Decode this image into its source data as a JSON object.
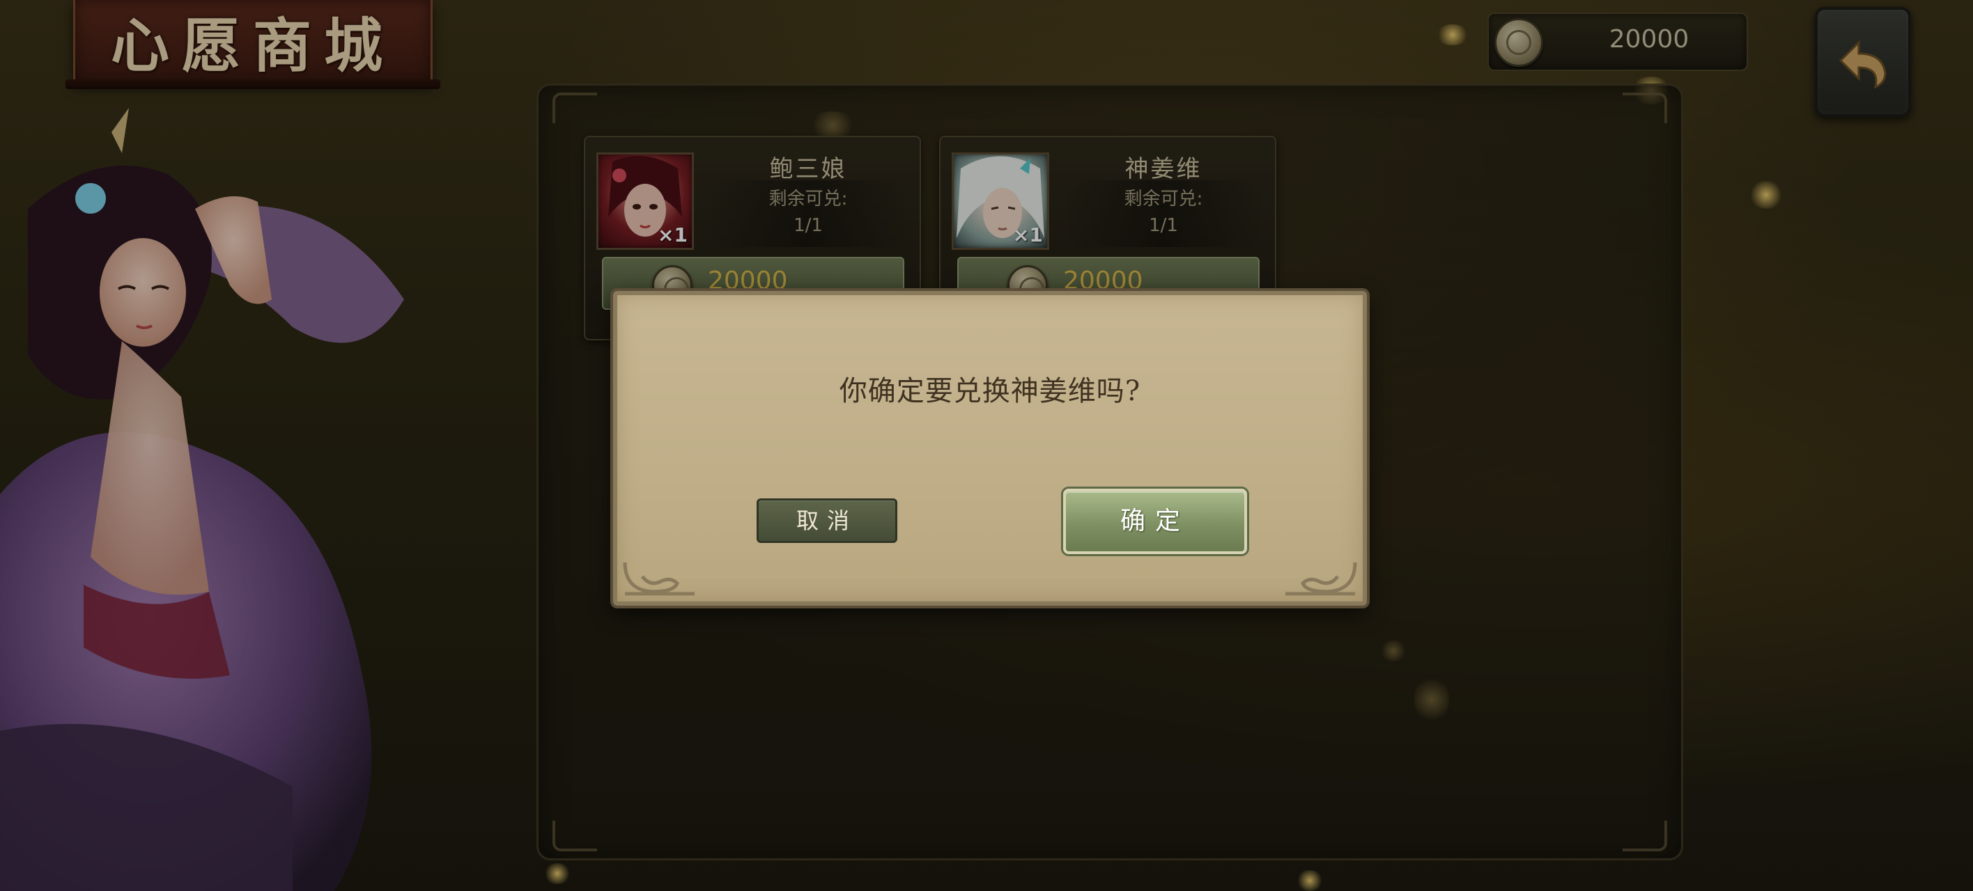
{
  "header": {
    "title": "心愿商城"
  },
  "currency": {
    "amount": "20000",
    "icon": "coin-icon"
  },
  "back_button": {
    "icon": "back-arrow-icon"
  },
  "items": [
    {
      "name": "鲍三娘",
      "qty": "×1",
      "remaining_label": "剩余可兑:",
      "remaining": "1/1",
      "price": "20000",
      "accent": "#7a1f24"
    },
    {
      "name": "神姜维",
      "qty": "×1",
      "remaining_label": "剩余可兑:",
      "remaining": "1/1",
      "price": "20000",
      "accent": "#c9d6c8"
    }
  ],
  "dialog": {
    "message": "你确定要兑换神姜维吗?",
    "cancel_label": "取消",
    "confirm_label": "确定"
  },
  "colors": {
    "panel": "#1f1b12",
    "dialog_bg": "#c7b692",
    "price_gold": "#d7b64a",
    "button_green": "#7f9163"
  }
}
